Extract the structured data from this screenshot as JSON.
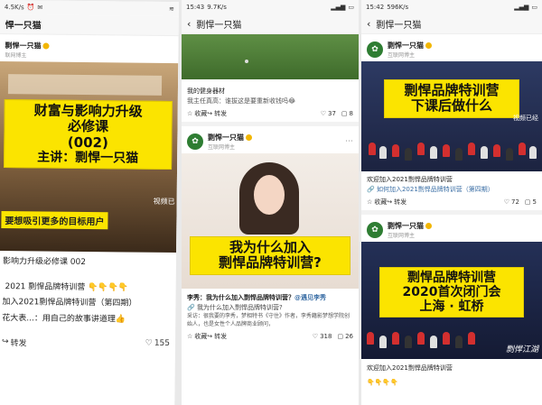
{
  "colors": {
    "banner": "#fbe400",
    "brand_green": "#2e7d32",
    "flag_red": "#d32f2f"
  },
  "phone1": {
    "status_speed": "4.5K/s",
    "title": "悍一只猫",
    "author_name": "剽悍一只猫",
    "author_sub": "联网博主",
    "banner_lines": [
      "财富与影响力升级",
      "必修课",
      "(002)",
      "主讲：剽悍一只猫"
    ],
    "sub_banner": "要想吸引更多的目标用户",
    "watermark": "视频已",
    "caption1": "影响力升级必修课 002",
    "caption2": " 2021 剽悍品牌特训营",
    "caption2_emoji": "👇👇👇👇",
    "caption3": "加入2021剽悍品牌特训营（第四期）",
    "caption4": "花大表...：用自己的故事讲道理👍",
    "forward": "转发",
    "likes": "155"
  },
  "phone2": {
    "time": "15:43",
    "status_speed": "9.7K/s",
    "title": "剽悍一只猫",
    "post_text": "我的健身器材",
    "post_text2": "我主任真高：谁拔这是要重新收钱吗😂",
    "collect": "收藏",
    "forward": "转发",
    "likes": "37",
    "comments": "8",
    "author_name": "剽悍一只猫",
    "author_sub": "互联网博主",
    "banner_lines": [
      "我为什么加入",
      "剽悍品牌特训营?"
    ],
    "quote_title": "李秀：我为什么加入剽悍品牌特训营？",
    "quote_source": "@遇见李秀",
    "link": "我为什么加入剽悍品牌特训营?",
    "body": "采访：很我要的李秀，梦相特书《守住》作者，李秀籍影梦想学院创始人，也是女性个人品牌商业顾问，",
    "likes2": "318",
    "comments2": "26"
  },
  "phone3": {
    "time": "15:42",
    "status_speed": "596K/s",
    "title": "剽悍一只猫",
    "author_name": "剽悍一只猫",
    "author_sub": "互联网博主",
    "banner1_lines": [
      "剽悍品牌特训营",
      "下课后做什么"
    ],
    "watermark1": "视频已经",
    "caption": "欢迎加入2021剽悍品牌特训营",
    "link": "如何加入2021剽悍品牌特训营（第四期）",
    "collect": "收藏",
    "forward": "转发",
    "likes": "72",
    "comments": "5",
    "banner2_lines": [
      "剽悍品牌特训营",
      "2020首次闭门会",
      "上海 · 虹桥"
    ],
    "watermark2": "剽悍江湖",
    "caption2": "欢迎加入2021剽悍品牌特训营",
    "emoji_row": "👇👇👇👇"
  }
}
